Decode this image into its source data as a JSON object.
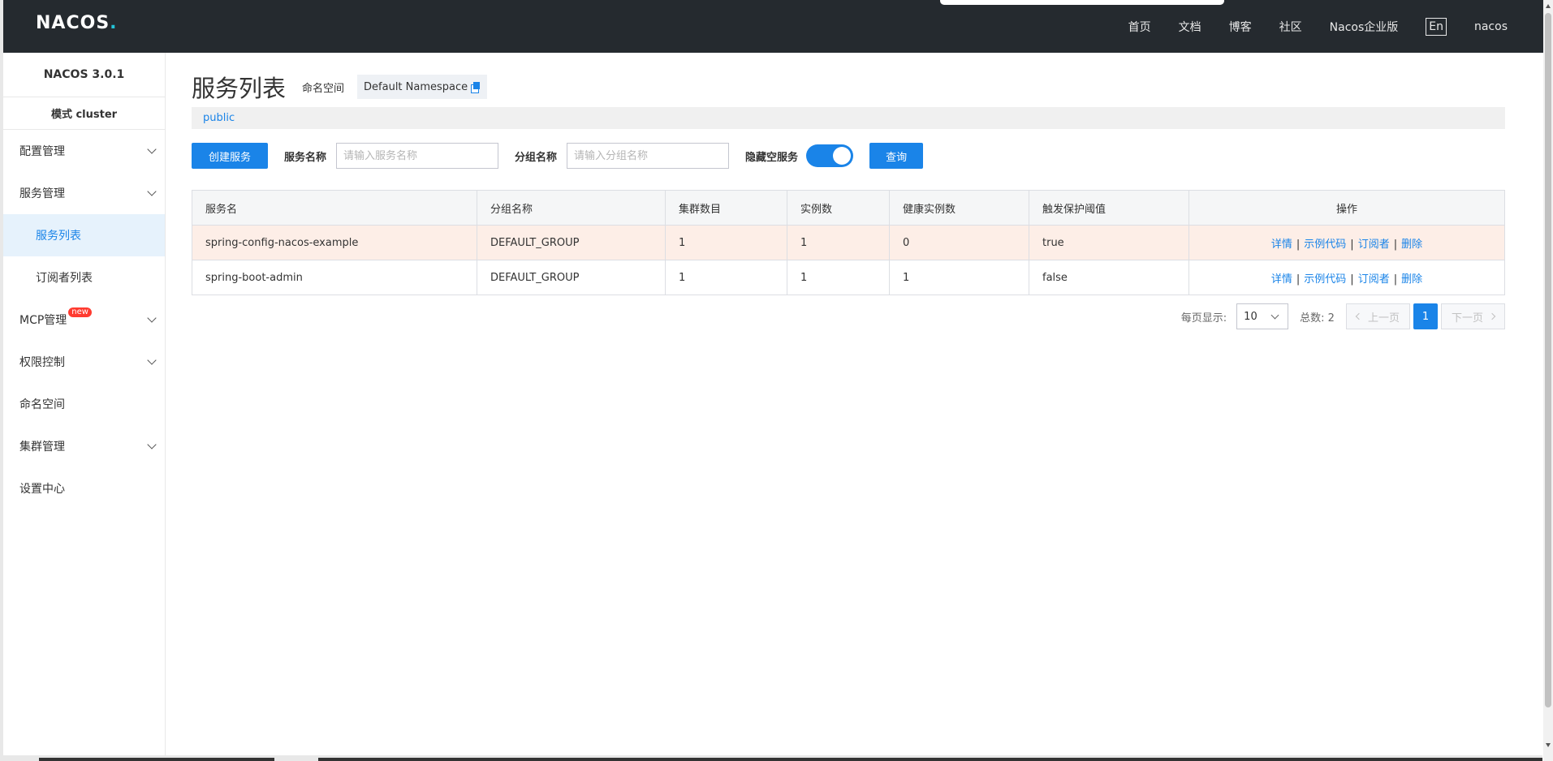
{
  "topbar": {
    "logo": {
      "pre": "NA",
      "mid": "CO",
      "post": "S",
      "dot": "."
    },
    "nav": [
      "首页",
      "文档",
      "博客",
      "社区",
      "Nacos企业版"
    ],
    "lang": "En",
    "user": "nacos"
  },
  "sidebar": {
    "version": "NACOS 3.0.1",
    "mode": "模式 cluster",
    "items": [
      {
        "label": "配置管理",
        "expandable": true
      },
      {
        "label": "服务管理",
        "expandable": true
      },
      {
        "label": "服务列表",
        "sub": true,
        "active": true
      },
      {
        "label": "订阅者列表",
        "sub": true
      },
      {
        "label": "MCP管理",
        "expandable": true,
        "badge": "new"
      },
      {
        "label": "权限控制",
        "expandable": true
      },
      {
        "label": "命名空间"
      },
      {
        "label": "集群管理",
        "expandable": true
      },
      {
        "label": "设置中心"
      }
    ]
  },
  "main": {
    "title": "服务列表",
    "ns_label": "命名空间",
    "ns_value": "Default Namespace",
    "ns_tab": "public",
    "create_button": "创建服务",
    "service_name_label": "服务名称",
    "service_name_placeholder": "请输入服务名称",
    "group_name_label": "分组名称",
    "group_name_placeholder": "请输入分组名称",
    "hide_empty_label": "隐藏空服务",
    "hide_empty_on": true,
    "query_button": "查询"
  },
  "table": {
    "headers": [
      "服务名",
      "分组名称",
      "集群数目",
      "实例数",
      "健康实例数",
      "触发保护阈值",
      "操作"
    ],
    "rows": [
      [
        "spring-config-nacos-example",
        "DEFAULT_GROUP",
        "1",
        "1",
        "0",
        "true"
      ],
      [
        "spring-boot-admin",
        "DEFAULT_GROUP",
        "1",
        "1",
        "1",
        "false"
      ]
    ],
    "ops": [
      "详情",
      "示例代码",
      "订阅者",
      "删除"
    ],
    "sep": "|"
  },
  "pager": {
    "page_size_label": "每页显示:",
    "page_size": "10",
    "total_label": "总数: 2",
    "prev": "上一页",
    "next": "下一页",
    "current": "1"
  },
  "colors": {
    "primary": "#1a84e8",
    "topbar": "#252a2f",
    "highlight_row": "#fdeee7"
  }
}
